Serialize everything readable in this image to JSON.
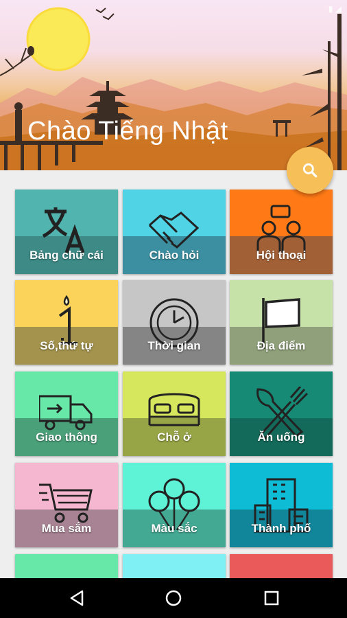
{
  "app": {
    "title": "Chào Tiếng Nhật"
  },
  "fab": {
    "icon": "search-icon",
    "color": "#f7bf58"
  },
  "categories": [
    {
      "label": "Bảng chữ cái",
      "icon": "translate-icon",
      "top": "#51b4ae",
      "bottom": "#3d8a86"
    },
    {
      "label": "Chào hỏi",
      "icon": "handshake-icon",
      "top": "#4fd3e5",
      "bottom": "#3b8fa0"
    },
    {
      "label": "Hội thoại",
      "icon": "conversation-icon",
      "top": "#ff7a16",
      "bottom": "#a26036"
    },
    {
      "label": "Số,thứ tự",
      "icon": "number-one-icon",
      "top": "#fbd35a",
      "bottom": "#a3934d"
    },
    {
      "label": "Thời gian",
      "icon": "clock-icon",
      "top": "#c6c6c6",
      "bottom": "#858585"
    },
    {
      "label": "Địa điểm",
      "icon": "flag-icon",
      "top": "#c7e2a8",
      "bottom": "#8fa07a"
    },
    {
      "label": "Giao thông",
      "icon": "truck-icon",
      "top": "#67e8a8",
      "bottom": "#4aa079"
    },
    {
      "label": "Chỗ ở",
      "icon": "bed-icon",
      "top": "#d7e75d",
      "bottom": "#98a546"
    },
    {
      "label": "Ăn uống",
      "icon": "fork-spoon-icon",
      "top": "#178a75",
      "bottom": "#146a5a"
    },
    {
      "label": "Mua sắm",
      "icon": "shopping-cart-icon",
      "top": "#f5b7cf",
      "bottom": "#a88393"
    },
    {
      "label": "Màu sắc",
      "icon": "balloons-icon",
      "top": "#5ef3d7",
      "bottom": "#43a993"
    },
    {
      "label": "Thành phố",
      "icon": "buildings-icon",
      "top": "#0fbcd6",
      "bottom": "#11869a"
    },
    {
      "label": "",
      "icon": "",
      "top": "#67e8a8",
      "bottom": "#4aa079"
    },
    {
      "label": "",
      "icon": "",
      "top": "#7ff0f4",
      "bottom": "#5aaaac"
    },
    {
      "label": "",
      "icon": "",
      "top": "#ea5a5a",
      "bottom": "#a44444"
    }
  ],
  "navbar": {
    "back": "back-icon",
    "home": "home-icon",
    "recents": "recents-icon"
  }
}
